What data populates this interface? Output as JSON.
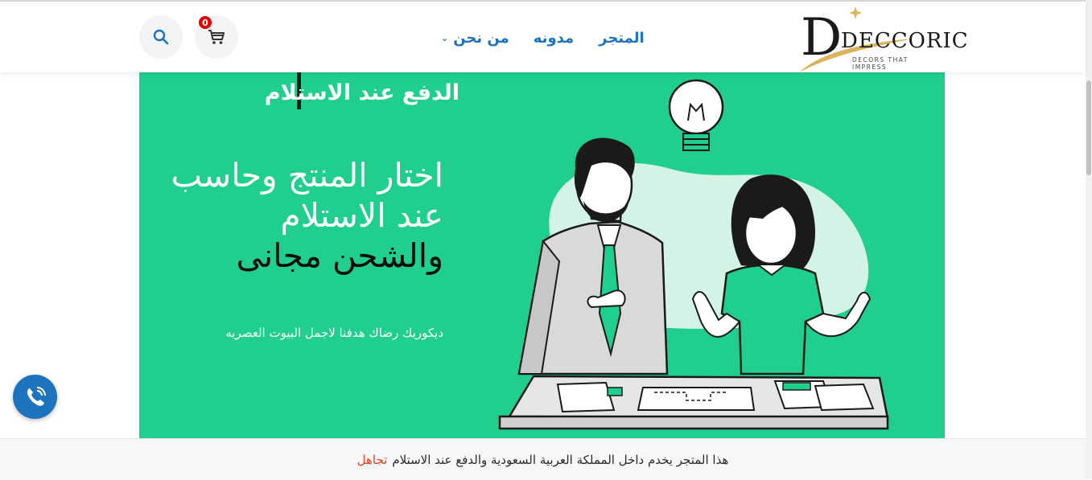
{
  "brand": {
    "logo_text": "DECCORIC",
    "tagline": "DECORS THAT IMPRESS",
    "colors": {
      "gold": "#d9b45a",
      "ink": "#1a1a1a"
    }
  },
  "header": {
    "nav": {
      "store": "المتجر",
      "blog": "مدونه",
      "about": "من نحن"
    },
    "cart_count": "0",
    "icons": {
      "search": "search-icon",
      "cart": "cart-icon",
      "dropdown": "chevron-down-icon"
    }
  },
  "hero": {
    "kicker": "الدفع عند الاستلام",
    "heading_light": "اختار المنتج وحاسب عند الاستلام",
    "heading_dark": "والشحن مجانى",
    "subtext": "ديكوريك رضاك هدفنا لاجمل البيوت العصريه",
    "background_color": "#20cf8d"
  },
  "floating": {
    "call_icon": "phone-call-icon"
  },
  "store_notice": {
    "text": "هذا المتجر يخدم داخل المملكة العربية السعودية والدفع عند الاستلام",
    "dismiss": "تجاهل"
  },
  "theme": {
    "link_color": "#1e73be",
    "notice_link_color": "#e2401c"
  }
}
